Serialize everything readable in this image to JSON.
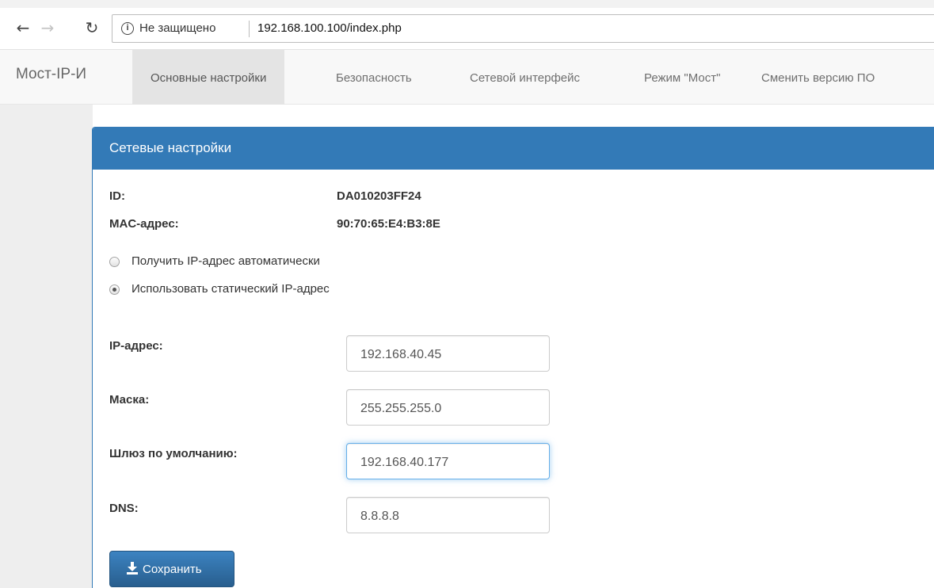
{
  "browser": {
    "security_text": "Не защищено",
    "url": "192.168.100.100/index.php"
  },
  "navbar": {
    "brand": "Мост-IP-И",
    "items": [
      {
        "label": "Основные настройки",
        "active": true
      },
      {
        "label": "Безопасность",
        "active": false
      },
      {
        "label": "Сетевой интерфейс",
        "active": false
      },
      {
        "label": "Режим \"Мост\"",
        "active": false
      },
      {
        "label": "Сменить версию ПО",
        "active": false
      }
    ]
  },
  "panel": {
    "title": "Сетевые настройки",
    "id_label": "ID:",
    "id_value": "DA010203FF24",
    "mac_label": "MAC-адрес:",
    "mac_value": "90:70:65:E4:B3:8E",
    "radio_auto": "Получить IP-адрес автоматически",
    "radio_static": "Использовать статический IP-адрес",
    "selected_mode": "static",
    "fields": {
      "ip_label": "IP-адрес:",
      "ip_value": "192.168.40.45",
      "mask_label": "Маска:",
      "mask_value": "255.255.255.0",
      "gateway_label": "Шлюз по умолчанию:",
      "gateway_value": "192.168.40.177",
      "dns_label": "DNS:",
      "dns_value": "8.8.8.8"
    },
    "save_label": "Сохранить"
  },
  "colors": {
    "primary": "#337ab7",
    "navbar_bg": "#f8f8f8",
    "active_nav_bg": "#e4e4e4",
    "focus_border": "#66afe9"
  },
  "icons": [
    "back-arrow-icon",
    "forward-arrow-icon",
    "reload-icon",
    "info-icon",
    "download-icon"
  ]
}
